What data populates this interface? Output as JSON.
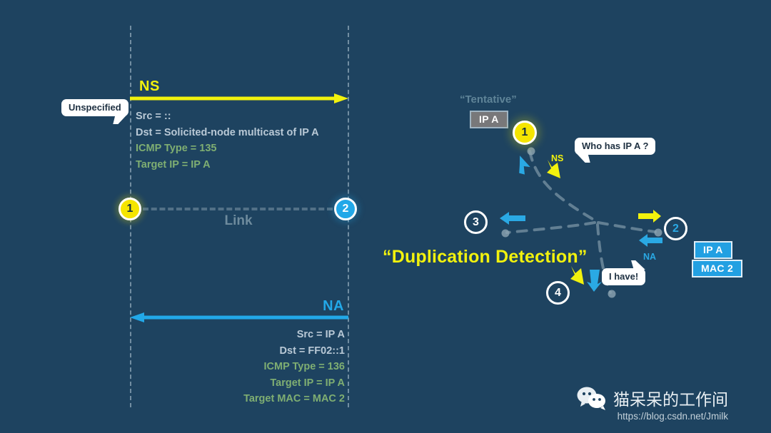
{
  "theme": {
    "background": "#1e4360",
    "yellow": "#f2f20d",
    "blue": "#22a8e8",
    "green": "#7fae72",
    "light_gray_text": "#b9c9d6",
    "muted_label": "#5f8498",
    "white": "#ffffff"
  },
  "sequence": {
    "ns": {
      "protocol_label": "NS",
      "arrow_direction": "left-to-right",
      "arrow_color": "#f2f20d",
      "callout": "Unspecified",
      "fields": [
        {
          "text": "Src = ::",
          "style": "head"
        },
        {
          "text": "Dst = Solicited-node multicast of IP A",
          "style": "head"
        },
        {
          "text": "ICMP Type = 135",
          "style": "green"
        },
        {
          "text": "Target IP = IP A",
          "style": "green"
        }
      ]
    },
    "na": {
      "protocol_label": "NA",
      "arrow_direction": "right-to-left",
      "arrow_color": "#22a8e8",
      "fields": [
        {
          "text": "Src = IP A",
          "style": "head"
        },
        {
          "text": "Dst = FF02::1",
          "style": "head"
        },
        {
          "text": "ICMP Type = 136",
          "style": "green"
        },
        {
          "text": "Target IP = IP A",
          "style": "green"
        },
        {
          "text": "Target MAC = MAC 2",
          "style": "green"
        }
      ]
    },
    "link_label": "Link",
    "nodes": [
      {
        "id": "1",
        "label": "1",
        "style": "yellow"
      },
      {
        "id": "2",
        "label": "2",
        "style": "blue"
      }
    ]
  },
  "topology": {
    "title": "“Duplication Detection”",
    "tentative_label": "“Tentative”",
    "tentative_badge": "IP A",
    "nodes": [
      {
        "id": "1",
        "label": "1",
        "style": "yellow"
      },
      {
        "id": "2",
        "label": "2",
        "style": "hollow-blue"
      },
      {
        "id": "3",
        "label": "3",
        "style": "hollow"
      },
      {
        "id": "4",
        "label": "4",
        "style": "hollow"
      }
    ],
    "node2_badges": [
      "IP A",
      "MAC 2"
    ],
    "mini_labels": {
      "ns": "NS",
      "na": "NA"
    },
    "bubbles": {
      "who_has": "Who has IP A ?",
      "i_have": "I have!"
    }
  },
  "watermark": {
    "icon": "wechat-icon",
    "name": "猫呆呆的工作间",
    "url": "https://blog.csdn.net/Jmilk"
  }
}
